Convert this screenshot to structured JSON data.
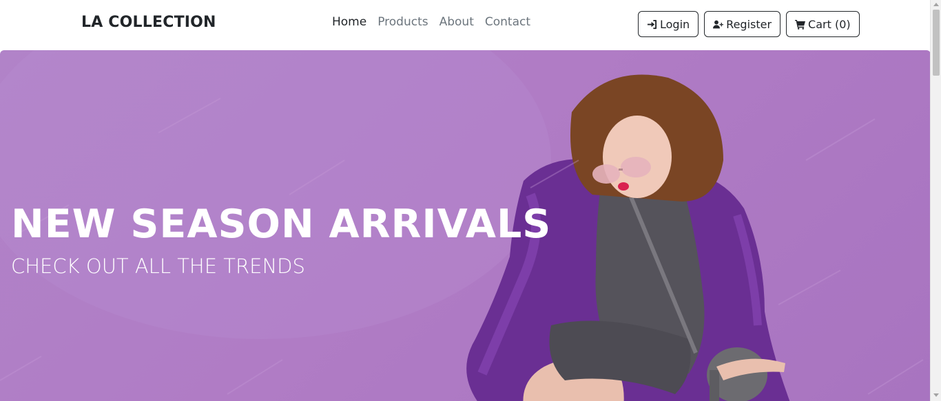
{
  "navbar": {
    "brand": "LA COLLECTION",
    "links": [
      {
        "label": "Home",
        "active": true
      },
      {
        "label": "Products",
        "active": false
      },
      {
        "label": "About",
        "active": false
      },
      {
        "label": "Contact",
        "active": false
      }
    ],
    "buttons": {
      "login": {
        "label": "Login",
        "icon": "sign-in-icon"
      },
      "register": {
        "label": "Register",
        "icon": "user-plus-icon"
      },
      "cart": {
        "label": "Cart (0)",
        "icon": "shopping-cart-icon"
      }
    }
  },
  "hero": {
    "title": "NEW SEASON ARRIVALS",
    "subtitle": "CHECK OUT ALL THE TRENDS",
    "background_color": "#b07cc5"
  }
}
